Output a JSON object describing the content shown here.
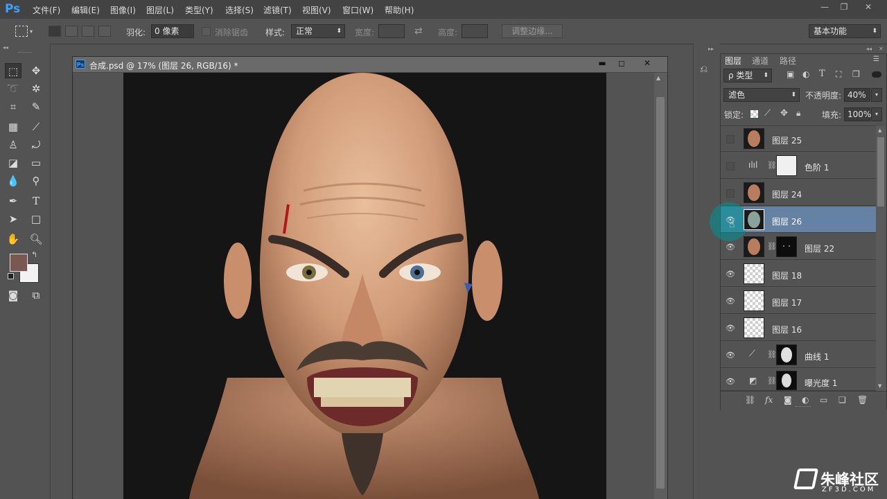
{
  "app": {
    "logo": "Ps"
  },
  "menu": [
    "文件(F)",
    "编辑(E)",
    "图像(I)",
    "图层(L)",
    "类型(Y)",
    "选择(S)",
    "滤镜(T)",
    "视图(V)",
    "窗口(W)",
    "帮助(H)"
  ],
  "window_controls": {
    "minimize": "—",
    "restore": "❐",
    "close": "✕"
  },
  "options": {
    "feather_label": "羽化:",
    "feather_value": "0 像素",
    "antialias_label": "消除锯齿",
    "style_label": "样式:",
    "style_value": "正常",
    "width_label": "宽度:",
    "height_label": "高度:",
    "refine_edge": "调整边缘...",
    "workspace": "基本功能"
  },
  "document": {
    "title": "合成.psd @ 17% (图层 26, RGB/16) *",
    "icon": "Ps"
  },
  "layers_panel": {
    "tabs": [
      "图层",
      "通道",
      "路径"
    ],
    "filter_label": "ρ 类型",
    "blend_mode": "滤色",
    "opacity_label": "不透明度:",
    "opacity_value": "40%",
    "lock_label": "锁定:",
    "fill_label": "填充:",
    "fill_value": "100%",
    "layers": [
      {
        "name": "图层 25",
        "visible": false,
        "thumb": "face"
      },
      {
        "name": "色阶 1",
        "visible": false,
        "thumb": "levels"
      },
      {
        "name": "图层 24",
        "visible": false,
        "thumb": "face"
      },
      {
        "name": "图层 26",
        "visible": true,
        "thumb": "face",
        "selected": true
      },
      {
        "name": "图层 22",
        "visible": true,
        "thumb": "face-mask"
      },
      {
        "name": "图层 18",
        "visible": true,
        "thumb": "transparent"
      },
      {
        "name": "图层 17",
        "visible": true,
        "thumb": "transparent"
      },
      {
        "name": "图层 16",
        "visible": true,
        "thumb": "transparent"
      },
      {
        "name": "曲线 1",
        "visible": true,
        "thumb": "curves"
      },
      {
        "name": "曝光度 1",
        "visible": true,
        "thumb": "exposure"
      }
    ]
  },
  "watermark": {
    "brand": "朱峰社区",
    "url": "ZF3D.COM"
  },
  "colors": {
    "foreground": "#7a5750",
    "background": "#f2f2f2",
    "selected_row": "#6581a3"
  }
}
